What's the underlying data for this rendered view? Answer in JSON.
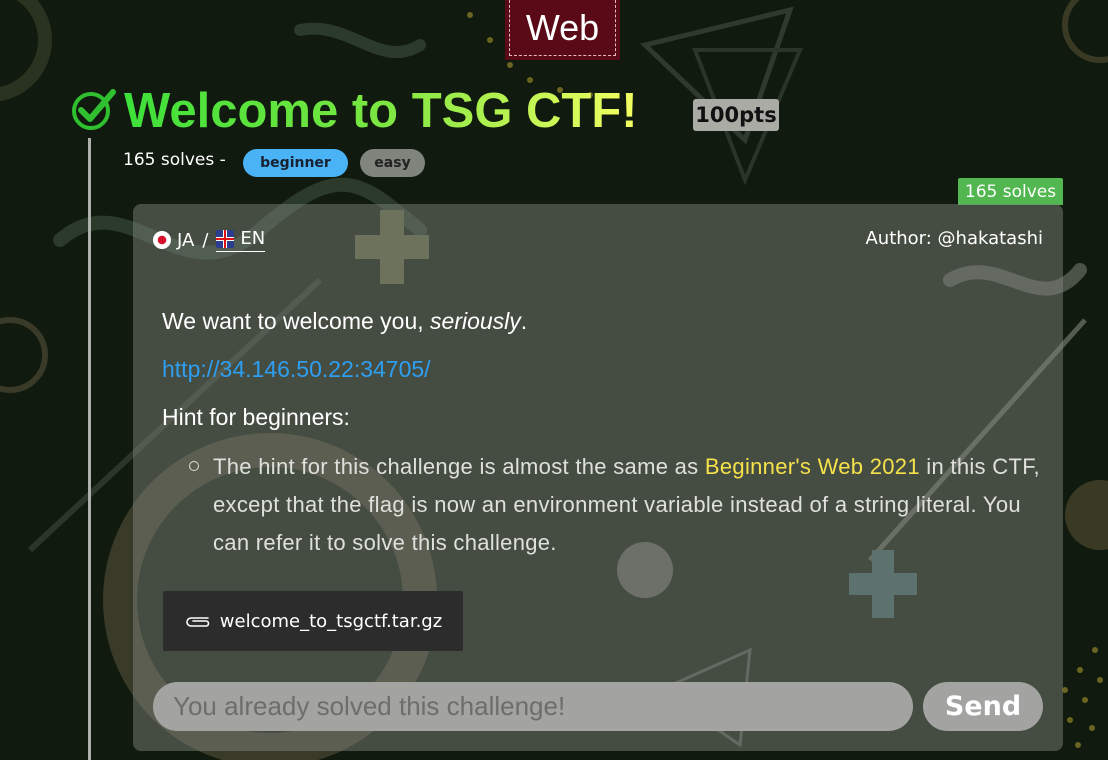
{
  "category": "Web",
  "challenge": {
    "title": "Welcome to TSG CTF!",
    "points": "100pts",
    "solves_text": "165 solves -",
    "tags": [
      "beginner",
      "easy"
    ],
    "solves_badge": "165 solves"
  },
  "card": {
    "lang_ja": "JA",
    "lang_sep": "/",
    "lang_en": "EN",
    "author": "Author: @hakatashi",
    "desc_plain": "We want to welcome you, ",
    "desc_em": "seriously",
    "desc_end": ".",
    "url": "http://34.146.50.22:34705/",
    "hint_title": "Hint for beginners:",
    "hint_pre": "The hint for this challenge is almost the same as ",
    "hint_link": "Beginner's Web 2021",
    "hint_post": " in this CTF, except that the flag is now an environment variable instead of a string literal. You can refer it to solve this challenge.",
    "file_name": "welcome_to_tsgctf.tar.gz",
    "flag_placeholder": "You already solved this challenge!",
    "send_label": "Send"
  },
  "colors": {
    "background": "#101a0e",
    "category": "#5a0a17",
    "check": "#2fbf2f",
    "tag_beginner": "#4ab3f5",
    "tag_easy": "#7f847c",
    "solves_badge": "#52b651",
    "link": "#2e9ef0",
    "highlight": "#f5e14a"
  }
}
